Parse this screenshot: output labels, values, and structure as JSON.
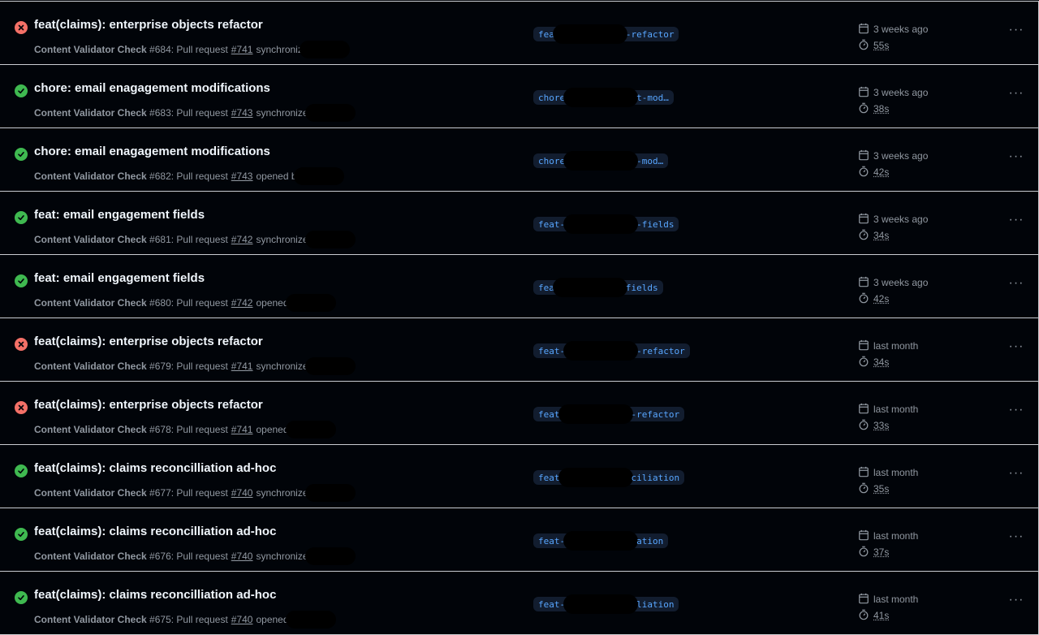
{
  "colors": {
    "failure": "#f47067",
    "success": "#3fb950",
    "branch_text": "#58a6ff",
    "branch_bg": "#121d2f",
    "background": "#010409"
  },
  "runs": [
    {
      "status": "failure",
      "title": "feat(claims): enterprise objects refactor",
      "workflow": "Content Validator Check",
      "run": "#684: Pull request",
      "pr": "#741",
      "event": "synchroniz",
      "branch_prefix": "fea",
      "branch_suffix": "-refactor",
      "when": "3 weeks ago",
      "duration": "55s"
    },
    {
      "status": "success",
      "title": "chore: email enagagement modifications",
      "workflow": "Content Validator Check",
      "run": "#683: Pull request",
      "pr": "#743",
      "event": "synchronize",
      "branch_prefix": "chore",
      "branch_suffix": "t-mod…",
      "when": "3 weeks ago",
      "duration": "38s"
    },
    {
      "status": "success",
      "title": "chore: email enagagement modifications",
      "workflow": "Content Validator Check",
      "run": "#682: Pull request",
      "pr": "#743",
      "event": "opened b",
      "branch_prefix": "chore",
      "branch_suffix": "-mod…",
      "when": "3 weeks ago",
      "duration": "42s"
    },
    {
      "status": "success",
      "title": "feat: email engagement fields",
      "workflow": "Content Validator Check",
      "run": "#681: Pull request",
      "pr": "#742",
      "event": "synchronize",
      "branch_prefix": "feat-",
      "branch_suffix": "-fields",
      "when": "3 weeks ago",
      "duration": "34s"
    },
    {
      "status": "success",
      "title": "feat: email engagement fields",
      "workflow": "Content Validator Check",
      "run": "#680: Pull request",
      "pr": "#742",
      "event": "opened",
      "branch_prefix": "fea",
      "branch_suffix": "fields",
      "when": "3 weeks ago",
      "duration": "42s"
    },
    {
      "status": "failure",
      "title": "feat(claims): enterprise objects refactor",
      "workflow": "Content Validator Check",
      "run": "#679: Pull request",
      "pr": "#741",
      "event": "synchronize",
      "branch_prefix": "feat-",
      "branch_suffix": "-refactor",
      "when": "last month",
      "duration": "34s"
    },
    {
      "status": "failure",
      "title": "feat(claims): enterprise objects refactor",
      "workflow": "Content Validator Check",
      "run": "#678: Pull request",
      "pr": "#741",
      "event": "opened",
      "branch_prefix": "feat",
      "branch_suffix": "-refactor",
      "when": "last month",
      "duration": "33s"
    },
    {
      "status": "success",
      "title": "feat(claims): claims reconcilliation ad-hoc",
      "workflow": "Content Validator Check",
      "run": "#677: Pull request",
      "pr": "#740",
      "event": "synchronize",
      "branch_prefix": "feat",
      "branch_suffix": "ciliation",
      "when": "last month",
      "duration": "35s"
    },
    {
      "status": "success",
      "title": "feat(claims): claims reconcilliation ad-hoc",
      "workflow": "Content Validator Check",
      "run": "#676: Pull request",
      "pr": "#740",
      "event": "synchronize",
      "branch_prefix": "feat-",
      "branch_suffix": "ation",
      "when": "last month",
      "duration": "37s"
    },
    {
      "status": "success",
      "title": "feat(claims): claims reconcilliation ad-hoc",
      "workflow": "Content Validator Check",
      "run": "#675: Pull request",
      "pr": "#740",
      "event": "opened",
      "branch_prefix": "feat-",
      "branch_suffix": "liation",
      "when": "last month",
      "duration": "41s"
    }
  ]
}
